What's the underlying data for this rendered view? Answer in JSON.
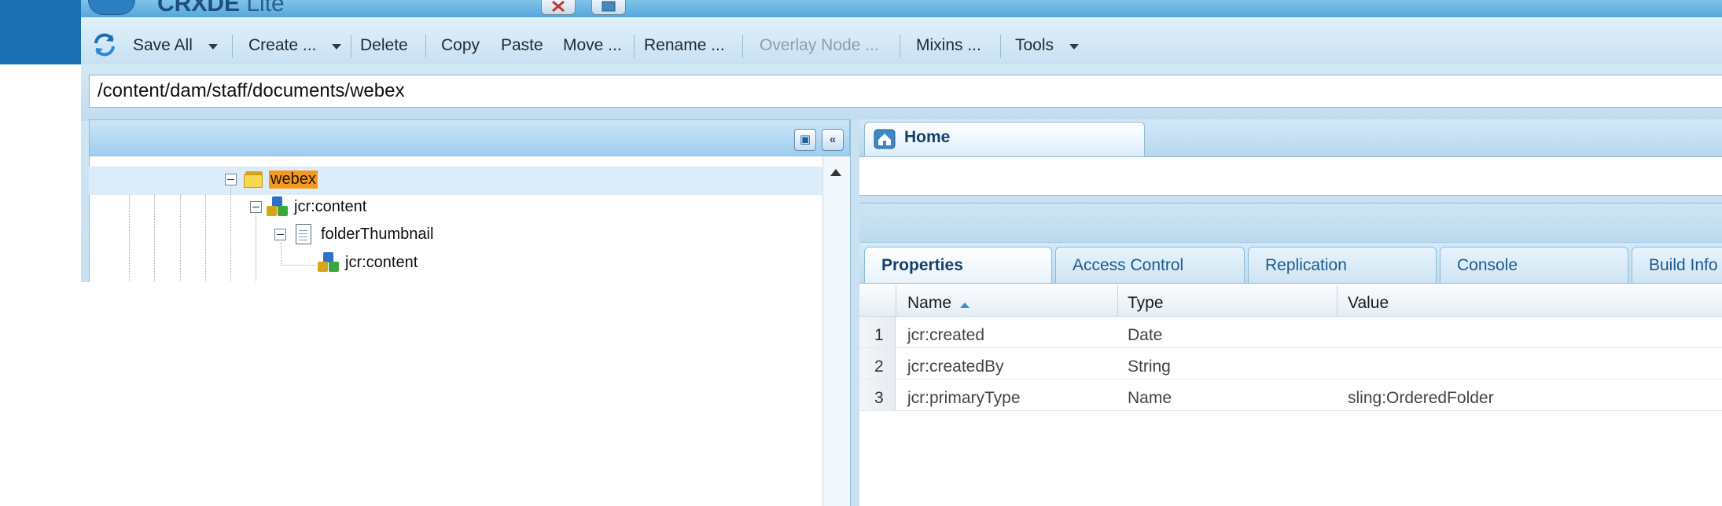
{
  "app": {
    "title_main": "CRXDE",
    "title_sub": "Lite"
  },
  "toolbar": {
    "items": [
      {
        "label": "Save All"
      },
      {
        "label": "Create ..."
      },
      {
        "label": "Delete"
      },
      {
        "label": "Copy"
      },
      {
        "label": "Paste"
      },
      {
        "label": "Move ..."
      },
      {
        "label": "Rename ..."
      },
      {
        "label": "Overlay Node ...",
        "disabled": true
      },
      {
        "label": "Mixins ..."
      },
      {
        "label": "Tools"
      }
    ]
  },
  "path": {
    "value": "/content/dam/staff/documents/webex"
  },
  "tree": {
    "nodes": [
      {
        "label": "webex",
        "icon": "folder-icon",
        "selected": true
      },
      {
        "label": "jcr:content",
        "icon": "node-cube-icon"
      },
      {
        "label": "folderThumbnail",
        "icon": "document-icon"
      },
      {
        "label": "jcr:content",
        "icon": "node-cube-icon"
      }
    ]
  },
  "editor": {
    "home_tab": "Home"
  },
  "properties": {
    "tabs": [
      "Properties",
      "Access Control",
      "Replication",
      "Console",
      "Build Info"
    ],
    "columns": [
      "Name",
      "Type",
      "Value"
    ],
    "rows": [
      {
        "num": "1",
        "name": "jcr:created",
        "type": "Date",
        "value": ""
      },
      {
        "num": "2",
        "name": "jcr:createdBy",
        "type": "String",
        "value": ""
      },
      {
        "num": "3",
        "name": "jcr:primaryType",
        "type": "Name",
        "value": "sling:OrderedFolder"
      }
    ]
  },
  "colors": {
    "accent": "#1b6fb3",
    "selection": "#f39a1c",
    "link_text": "#1d5a8f"
  }
}
